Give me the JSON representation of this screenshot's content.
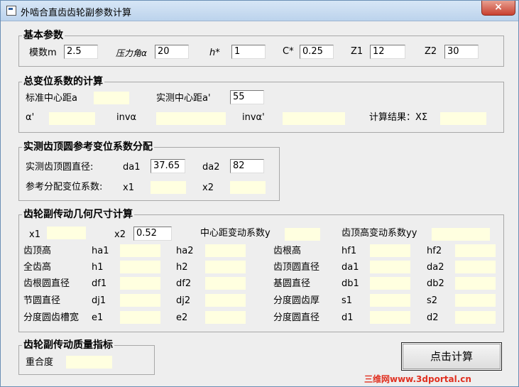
{
  "window": {
    "title": "外啮合直齿齿轮副参数计算",
    "close": "×"
  },
  "basic": {
    "legend": "基本参数",
    "items": [
      {
        "label": "模数m",
        "value": "2.5"
      },
      {
        "label": "压力角α",
        "value": "20"
      },
      {
        "label": "h*",
        "value": "1"
      },
      {
        "label": "C*",
        "value": "0.25"
      },
      {
        "label": "Z1",
        "value": "12"
      },
      {
        "label": "Z2",
        "value": "30"
      }
    ]
  },
  "total": {
    "legend": "总变位系数的计算",
    "std_center_label": "标准中心距a",
    "meas_center_label": "实测中心距a'",
    "meas_center_value": "55",
    "alpha_label": "α'",
    "inv_alpha_label": "invα",
    "inv_alpha_p_label": "invα'",
    "result_label": "计算结果：XΣ"
  },
  "measured": {
    "legend": "实测齿顶圆参考变位系数分配",
    "tip_dia_label": "实测齿顶圆直径:",
    "da1_label": "da1",
    "da1_value": "37.65",
    "da2_label": "da2",
    "da2_value": "82",
    "ref_label": "参考分配变位系数:",
    "x1_label": "x1",
    "x2_label": "x2"
  },
  "geometry": {
    "legend": "齿轮副传动几何尺寸计算",
    "x1_label": "x1",
    "x2_label": "x2",
    "x2_value": "0.52",
    "center_shift_label": "中心距变动系数y",
    "tip_shift_label": "齿顶高变动系数yy",
    "rows": [
      {
        "left": "齿顶高",
        "l1": "ha1",
        "l2": "ha2",
        "right": "齿根高",
        "r1": "hf1",
        "r2": "hf2"
      },
      {
        "left": "全齿高",
        "l1": "h1",
        "l2": "h2",
        "right": "齿顶圆直径",
        "r1": "da1",
        "r2": "da2"
      },
      {
        "left": "齿根圆直径",
        "l1": "df1",
        "l2": "df2",
        "right": "基圆直径",
        "r1": "db1",
        "r2": "db2"
      },
      {
        "left": "节圆直径",
        "l1": "dj1",
        "l2": "dj2",
        "right": "分度圆齿厚",
        "r1": "s1",
        "r2": "s2"
      },
      {
        "left": "分度圆齿槽宽",
        "l1": "e1",
        "l2": "e2",
        "right": "分度圆直径",
        "r1": "d1",
        "r2": "d2"
      }
    ]
  },
  "quality": {
    "legend": "齿轮副传动质量指标",
    "overlap_label": "重合度"
  },
  "actions": {
    "calc_label": "点击计算"
  },
  "watermark": "三维网www.3dportal.cn"
}
